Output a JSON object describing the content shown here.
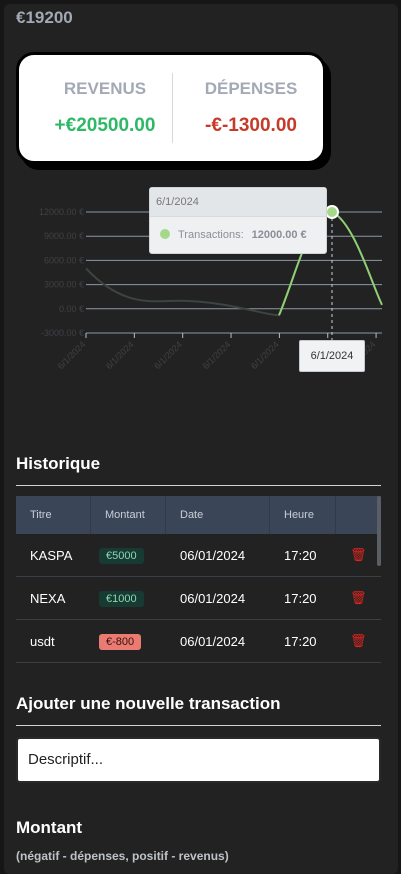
{
  "balance": "€19200",
  "summary": {
    "revenus_label": "REVENUS",
    "revenus_value": "+€20500.00",
    "depenses_label": "DÉPENSES",
    "depenses_value": "-€-1300.00"
  },
  "chart_data": {
    "type": "line",
    "ylim": [
      -3000,
      12000
    ],
    "y_ticks": [
      "12000.00 €",
      "9000.00 €",
      "6000.00 €",
      "3000.00 €",
      "0.00 €",
      "-3000.00 €"
    ],
    "x_ticks": [
      "6/1/2024",
      "6/1/2024",
      "6/1/2024",
      "6/1/2024",
      "6/1/2024",
      "6/1/2024",
      "6/1/2024"
    ],
    "series": [
      {
        "name": "Transactions",
        "color": "#8fcf76",
        "points": [
          {
            "x": "6/1/2024",
            "y": 5000
          },
          {
            "x": "6/1/2024",
            "y": 1000
          },
          {
            "x": "6/1/2024",
            "y": -800
          },
          {
            "x": "6/1/2024",
            "y": 12000
          },
          {
            "x": "6/1/2024",
            "y": 500
          }
        ]
      }
    ],
    "tooltip": {
      "date": "6/1/2024",
      "series_name": "Transactions:",
      "value": "12000.00 €"
    },
    "crosshair_label": "6/1/2024"
  },
  "history": {
    "title": "Historique",
    "columns": [
      "Titre",
      "Montant",
      "Date",
      "Heure",
      ""
    ],
    "rows": [
      {
        "titre": "KASPA",
        "montant": "€5000",
        "date": "06/01/2024",
        "heure": "17:20",
        "type": "pos"
      },
      {
        "titre": "NEXA",
        "montant": "€1000",
        "date": "06/01/2024",
        "heure": "17:20",
        "type": "pos"
      },
      {
        "titre": "usdt",
        "montant": "€-800",
        "date": "06/01/2024",
        "heure": "17:20",
        "type": "neg"
      }
    ]
  },
  "add": {
    "title": "Ajouter une nouvelle transaction",
    "descriptif_value": "Descriptif...",
    "montant_title": "Montant",
    "montant_note": "(négatif - dépenses, positif - revenus)"
  },
  "icons": {
    "delete": "trash-icon"
  }
}
